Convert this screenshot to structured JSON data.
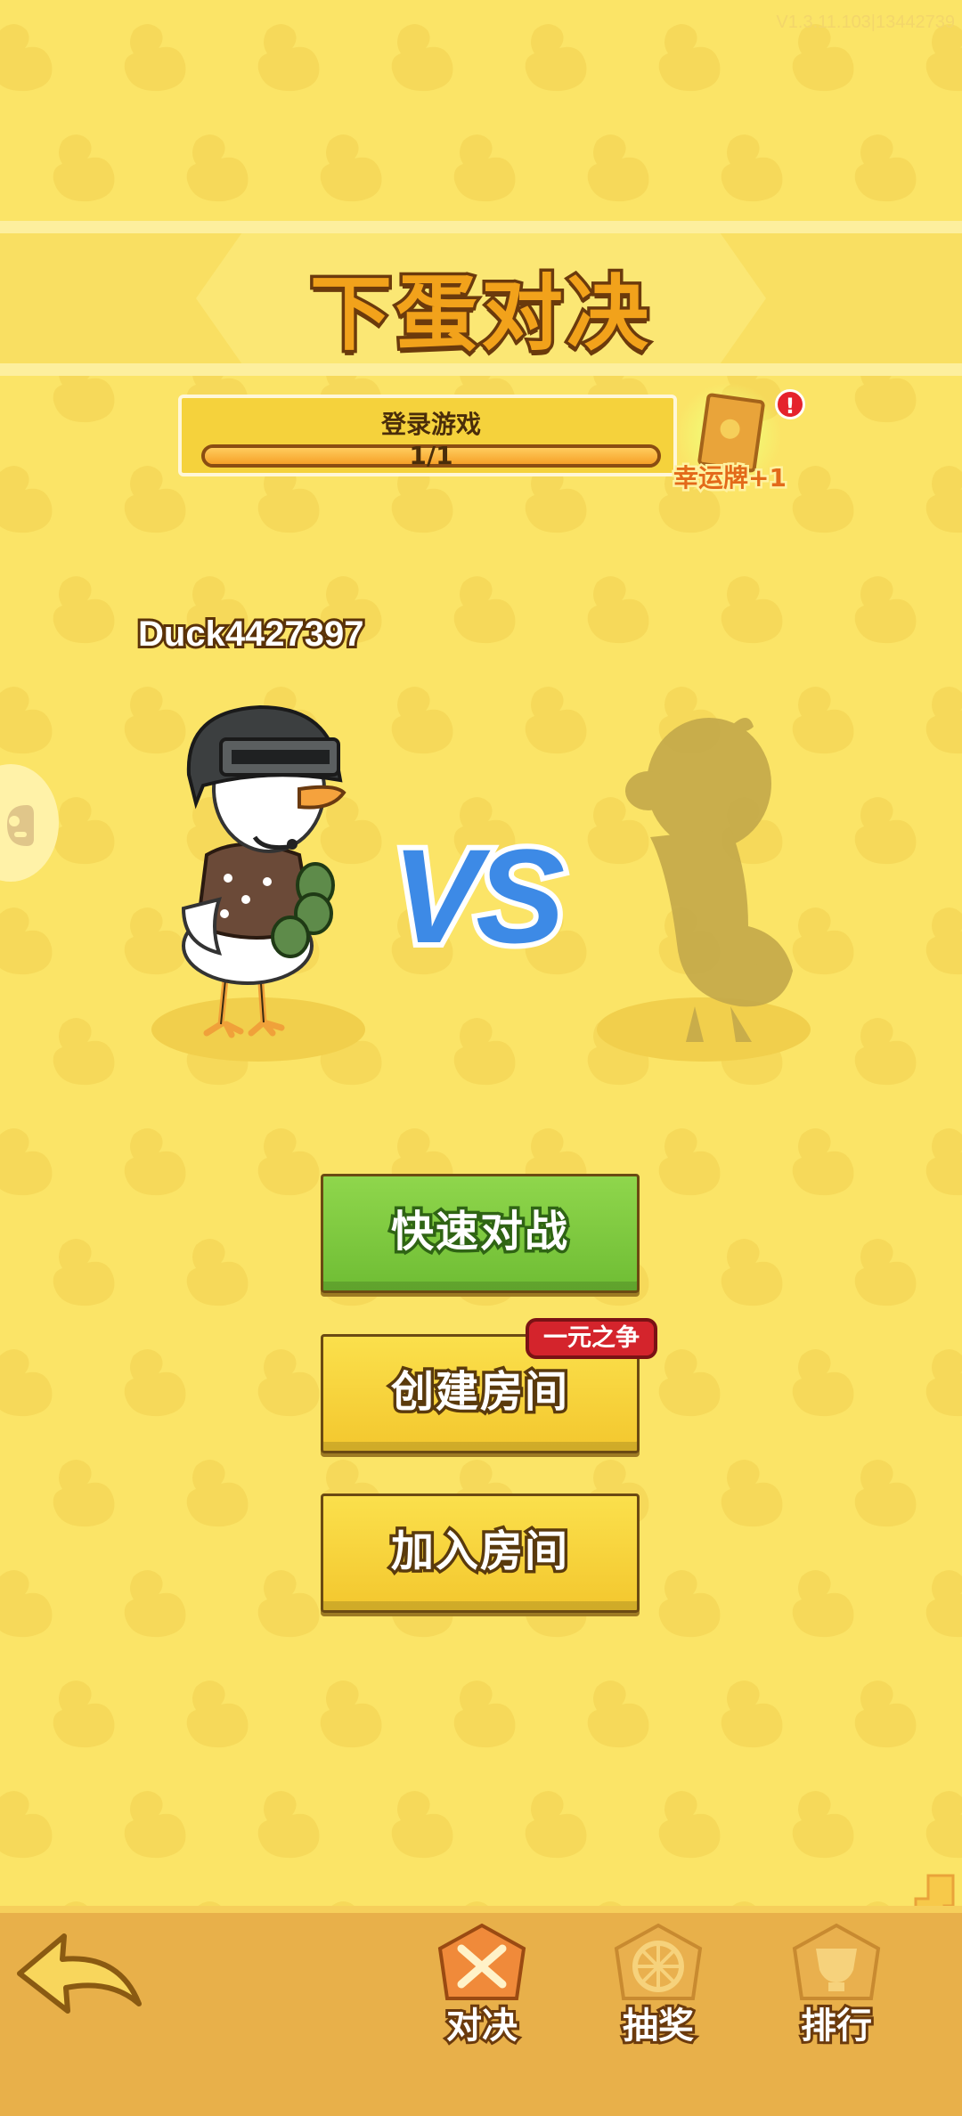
{
  "version": "V1.3.11.103|13442739",
  "title": "下蛋对决",
  "task": {
    "label": "登录游戏",
    "progress_text": "1/1",
    "progress": 1.0,
    "reward_label": "幸运牌+1",
    "alert": "!"
  },
  "player": {
    "name": "Duck4427397"
  },
  "vs": "VS",
  "buttons": {
    "quick_match": "快速对战",
    "create_room": "创建房间",
    "create_room_tag": "一元之争",
    "join_room": "加入房间"
  },
  "nav": {
    "duel": "对决",
    "lottery": "抽奖",
    "rank": "排行"
  },
  "colors": {
    "background": "#fbe467",
    "quick_match": "#7cc83c",
    "vs": "#3d8ae6",
    "navbar": "#e8b04a"
  }
}
